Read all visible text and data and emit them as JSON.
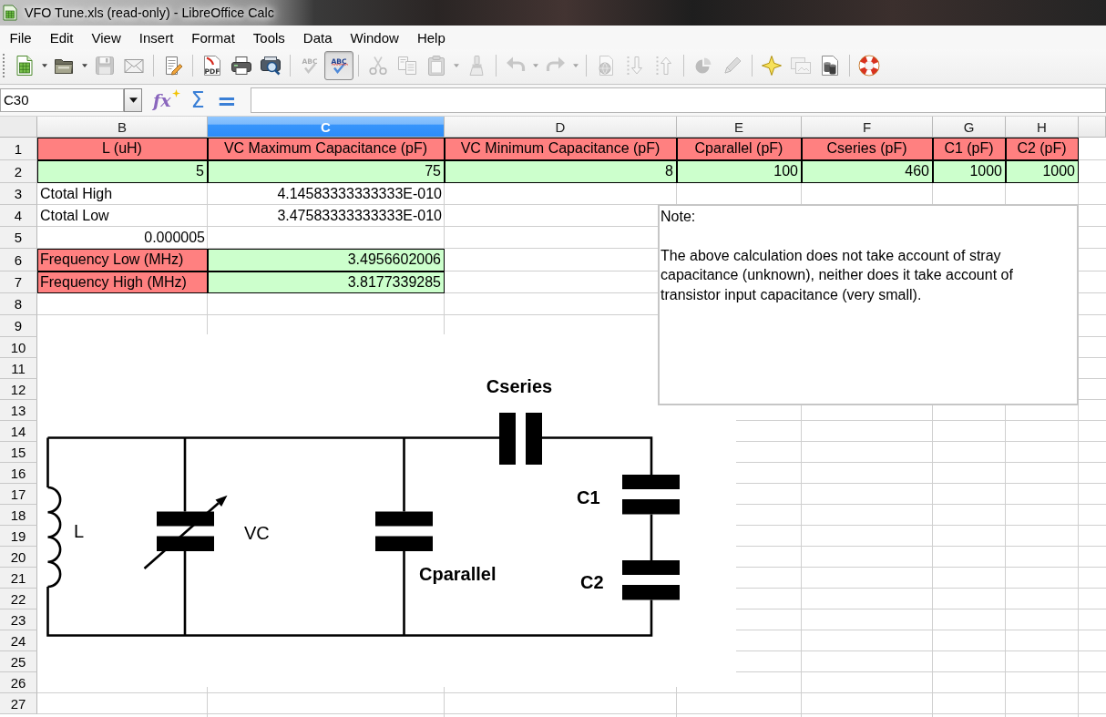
{
  "window": {
    "title": "VFO Tune.xls (read-only) - LibreOffice Calc"
  },
  "menu": [
    "File",
    "Edit",
    "View",
    "Insert",
    "Format",
    "Tools",
    "Data",
    "Window",
    "Help"
  ],
  "toolbar": {
    "groups": [
      [
        {
          "kind": "new",
          "disabled": false,
          "pressed": false,
          "dropdown": true
        },
        {
          "kind": "open",
          "disabled": false,
          "pressed": false,
          "dropdown": true
        },
        {
          "kind": "save",
          "disabled": true,
          "pressed": false,
          "dropdown": false
        },
        {
          "kind": "email",
          "disabled": false,
          "pressed": false,
          "dropdown": false
        }
      ],
      [
        {
          "kind": "edit",
          "disabled": false,
          "pressed": false,
          "dropdown": false
        }
      ],
      [
        {
          "kind": "pdf",
          "text": "PDF",
          "disabled": false,
          "pressed": false,
          "dropdown": false
        },
        {
          "kind": "print",
          "disabled": false,
          "pressed": false,
          "dropdown": false
        },
        {
          "kind": "preview",
          "disabled": false,
          "pressed": false,
          "dropdown": false
        }
      ],
      [
        {
          "kind": "spelling",
          "text": "ABC",
          "disabled": true,
          "pressed": false,
          "dropdown": false
        },
        {
          "kind": "autospell",
          "text": "ABC",
          "disabled": false,
          "pressed": true,
          "dropdown": false
        }
      ],
      [
        {
          "kind": "cut",
          "disabled": true,
          "pressed": false,
          "dropdown": false
        },
        {
          "kind": "copy",
          "disabled": true,
          "pressed": false,
          "dropdown": false
        },
        {
          "kind": "paste",
          "disabled": true,
          "pressed": false,
          "dropdown": true
        },
        {
          "kind": "clone",
          "disabled": true,
          "pressed": false,
          "dropdown": false
        }
      ],
      [
        {
          "kind": "undo",
          "disabled": true,
          "pressed": false,
          "dropdown": true
        },
        {
          "kind": "redo",
          "disabled": true,
          "pressed": false,
          "dropdown": true
        }
      ],
      [
        {
          "kind": "hyperlink",
          "disabled": true,
          "pressed": false,
          "dropdown": false
        },
        {
          "kind": "ascending",
          "disabled": true,
          "pressed": false,
          "dropdown": false
        },
        {
          "kind": "descending",
          "disabled": true,
          "pressed": false,
          "dropdown": false
        }
      ],
      [
        {
          "kind": "chart",
          "disabled": true,
          "pressed": false,
          "dropdown": false
        },
        {
          "kind": "draw",
          "disabled": true,
          "pressed": false,
          "dropdown": false
        }
      ],
      [
        {
          "kind": "navigator",
          "disabled": false,
          "pressed": false,
          "dropdown": false
        },
        {
          "kind": "gallery",
          "disabled": true,
          "pressed": false,
          "dropdown": false
        },
        {
          "kind": "datasource",
          "disabled": false,
          "pressed": false,
          "dropdown": false
        }
      ],
      [
        {
          "kind": "help",
          "disabled": false,
          "pressed": false,
          "dropdown": false
        }
      ]
    ]
  },
  "formula_bar": {
    "name_box": "C30",
    "function_glyph": "fx",
    "sum_glyph": "Σ",
    "equals_glyph": "="
  },
  "sheet": {
    "columns": [
      {
        "label": "B",
        "selected": false
      },
      {
        "label": "C",
        "selected": true
      },
      {
        "label": "D",
        "selected": false
      },
      {
        "label": "E",
        "selected": false
      },
      {
        "label": "F",
        "selected": false
      },
      {
        "label": "G",
        "selected": false
      },
      {
        "label": "H",
        "selected": false
      }
    ],
    "rows": [
      {
        "number": "1",
        "cells": [
          {
            "kind": "heading",
            "text": "L (uH)",
            "color": "#ff8080"
          },
          {
            "kind": "heading",
            "text": "VC Maximum Capacitance (pF)",
            "color": "#ff8080"
          },
          {
            "kind": "heading",
            "text": "VC Minimum Capacitance (pF)",
            "color": "#ff8080"
          },
          {
            "kind": "heading",
            "text": "Cparallel (pF)",
            "color": "#ff8080"
          },
          {
            "kind": "heading",
            "text": "Cseries (pF)",
            "color": "#ff8080"
          },
          {
            "kind": "heading",
            "text": "C1 (pF)",
            "color": "#ff8080"
          },
          {
            "kind": "heading",
            "text": "C2 (pF)",
            "color": "#ff8080"
          }
        ]
      },
      {
        "number": "2",
        "cells": [
          {
            "kind": "number",
            "text": "5",
            "color": "#ccffcc"
          },
          {
            "kind": "number",
            "text": "75",
            "color": "#ccffcc"
          },
          {
            "kind": "number",
            "text": "8",
            "color": "#ccffcc"
          },
          {
            "kind": "number",
            "text": "100",
            "color": "#ccffcc"
          },
          {
            "kind": "number",
            "text": "460",
            "color": "#ccffcc"
          },
          {
            "kind": "number",
            "text": "1000",
            "color": "#ccffcc"
          },
          {
            "kind": "number",
            "text": "1000",
            "color": "#ccffcc"
          }
        ]
      },
      {
        "number": "3",
        "cells": [
          {
            "kind": "text",
            "text": "Ctotal High"
          },
          {
            "kind": "number",
            "text": "4.14583333333333E-010"
          }
        ]
      },
      {
        "number": "4",
        "cells": [
          {
            "kind": "text",
            "text": "Ctotal Low"
          },
          {
            "kind": "number",
            "text": "3.47583333333333E-010"
          }
        ]
      },
      {
        "number": "5",
        "cells": [
          {
            "kind": "number",
            "text": "0.000005"
          }
        ]
      },
      {
        "number": "6",
        "cells": [
          {
            "kind": "text",
            "text": "Frequency Low (MHz)",
            "color": "#ff8080"
          },
          {
            "kind": "number",
            "text": "3.4956602006",
            "color": "#ccffcc"
          }
        ]
      },
      {
        "number": "7",
        "cells": [
          {
            "kind": "text",
            "text": "Frequency High (MHz)",
            "color": "#ff8080"
          },
          {
            "kind": "number",
            "text": "3.8177339285",
            "color": "#ccffcc"
          }
        ]
      },
      {
        "number": "8"
      },
      {
        "number": "9"
      },
      {
        "number": "10"
      },
      {
        "number": "11"
      },
      {
        "number": "12"
      },
      {
        "number": "13"
      },
      {
        "number": "14"
      },
      {
        "number": "15"
      },
      {
        "number": "16"
      },
      {
        "number": "17"
      },
      {
        "number": "18"
      },
      {
        "number": "19"
      },
      {
        "number": "20"
      },
      {
        "number": "21"
      },
      {
        "number": "22"
      },
      {
        "number": "23"
      },
      {
        "number": "24"
      },
      {
        "number": "25"
      },
      {
        "number": "26"
      },
      {
        "number": "27"
      }
    ]
  },
  "note": {
    "title": "Note:",
    "text": "The above calculation does not take account of stray capacitance (unknown), neither does it take account of transistor input capacitance (very small)."
  },
  "circuit": {
    "components": [
      {
        "kind": "inductor",
        "label": "L"
      },
      {
        "kind": "variable",
        "label": "VC"
      },
      {
        "kind": "capacitor",
        "label": "Cparallel"
      },
      {
        "kind": "capacitor",
        "label": "Cseries"
      },
      {
        "kind": "capacitor",
        "label": "C1"
      },
      {
        "kind": "capacitor",
        "label": "C2"
      }
    ]
  }
}
